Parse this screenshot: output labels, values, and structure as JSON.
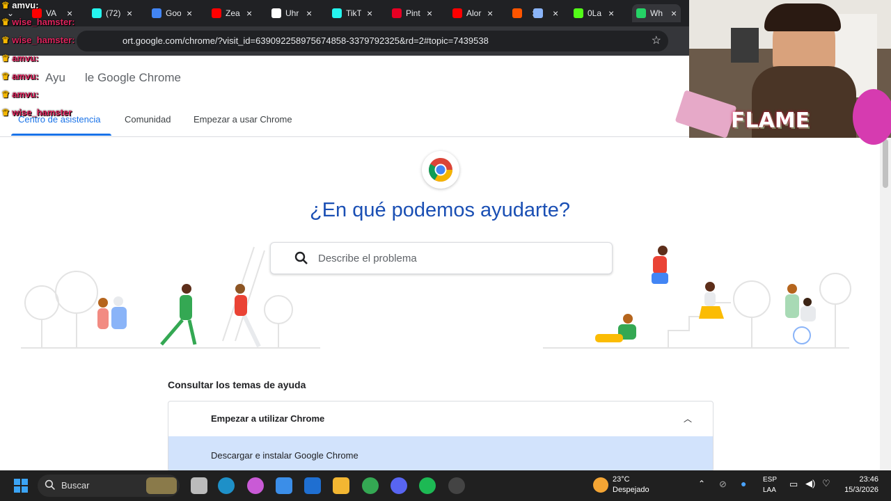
{
  "browser": {
    "tabs": [
      {
        "title": "VA",
        "icon": "youtube-icon",
        "color": "#ff0000"
      },
      {
        "title": "(72)",
        "icon": "tiktok-icon",
        "color": "#25f4ee"
      },
      {
        "title": "Goo",
        "icon": "gemini-icon",
        "color": "#4285f4"
      },
      {
        "title": "Zea",
        "icon": "youtube-icon",
        "color": "#ff0000"
      },
      {
        "title": "Uhr",
        "icon": "genius-icon",
        "color": "#ffffff"
      },
      {
        "title": "TikT",
        "icon": "tiktok-icon",
        "color": "#25f4ee"
      },
      {
        "title": "Pint",
        "icon": "pinterest-icon",
        "color": "#e60023"
      },
      {
        "title": "Alor",
        "icon": "youtube-icon",
        "color": "#ff0000"
      },
      {
        "title": "",
        "icon": "soundcloud-icon",
        "color": "#ff5500"
      },
      {
        "title": "",
        "icon": "monitor-icon",
        "color": "#8ab4f8"
      },
      {
        "title": "0La",
        "icon": "kick-icon",
        "color": "#53fc18"
      },
      {
        "title": "Wh",
        "icon": "whatsapp-icon",
        "color": "#25d366"
      }
    ],
    "url": "ort.google.com/chrome/?visit_id=639092258975674858-3379792325&rd=2#topic=7439538",
    "bookmark_icon": "star-icon"
  },
  "page": {
    "site_title_left": "Ayu",
    "site_title_right": "le Google Chrome",
    "nav": {
      "help_center": "Centro de asistencia",
      "community": "Comunidad",
      "get_started": "Empezar a usar Chrome"
    },
    "hero_title": "¿En qué podemos ayudarte?",
    "search_placeholder": "Describe el problema",
    "topics_heading": "Consultar los temas de ayuda",
    "accordion": {
      "title": "Empezar a utilizar Chrome",
      "items": [
        "Descargar e instalar Google Chrome"
      ]
    },
    "accent_color": "#1a73e8"
  },
  "chat_overlay": [
    {
      "user": "amvu:",
      "color": "#ffffff"
    },
    {
      "user": "wise_hamster:",
      "color": "#e0245e"
    },
    {
      "user": "wise_hamster:",
      "color": "#e0245e"
    },
    {
      "user": "amvu:",
      "color": "#e0245e"
    },
    {
      "user": "amvu:",
      "color": "#e0245e"
    },
    {
      "user": "amvu:",
      "color": "#e0245e"
    },
    {
      "user": "wise_hamster",
      "color": "#e0245e"
    }
  ],
  "webcam": {
    "banner_text": "FLAME"
  },
  "taskbar": {
    "search_label": "Buscar",
    "weather_temp": "23°C",
    "weather_desc": "Despejado",
    "lang_code": "ESP",
    "lang_layout": "LAA",
    "time": "23:46",
    "date": "15/3/2026"
  }
}
